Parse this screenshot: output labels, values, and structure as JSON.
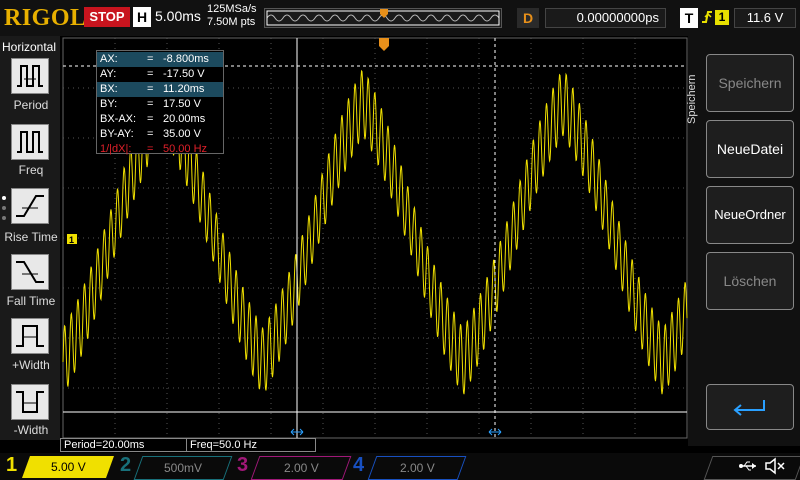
{
  "brand": "RIGOL",
  "run_state": "STOP",
  "horizontal": {
    "label": "H",
    "scale": "5.00ms",
    "sample_rate": "125MSa/s",
    "points": "7.50M pts"
  },
  "delay": {
    "label": "D",
    "value": "0.00000000ps"
  },
  "trigger": {
    "label": "T",
    "edge_icon": "rising-edge-icon",
    "source": "1",
    "level": "11.6 V"
  },
  "left_panel": {
    "title": "Horizontal",
    "items": [
      {
        "label": "Period",
        "icon": "period-measure-icon"
      },
      {
        "label": "Freq",
        "icon": "frequency-measure-icon"
      },
      {
        "label": "Rise Time",
        "icon": "rise-time-icon"
      },
      {
        "label": "Fall Time",
        "icon": "fall-time-icon"
      },
      {
        "label": "+Width",
        "icon": "positive-width-icon"
      },
      {
        "label": "-Width",
        "icon": "negative-width-icon"
      }
    ]
  },
  "right_panel": {
    "title": "Speichern",
    "buttons": [
      {
        "label": "Speichern",
        "enabled": false
      },
      {
        "label": "NeueDatei",
        "enabled": true
      },
      {
        "label": "NeueOrdner",
        "enabled": true
      },
      {
        "label": "Löschen",
        "enabled": false
      },
      {
        "label": "",
        "icon": "enter-return-icon",
        "enabled": true
      }
    ]
  },
  "cursor_table": [
    {
      "key": "AX:",
      "eq": "=",
      "value": "-8.800ms",
      "highlight": true
    },
    {
      "key": "AY:",
      "eq": "=",
      "value": "-17.50 V"
    },
    {
      "key": "BX:",
      "eq": "=",
      "value": "11.20ms",
      "highlight": true
    },
    {
      "key": "BY:",
      "eq": "=",
      "value": "17.50 V"
    },
    {
      "key": "BX-AX:",
      "eq": "=",
      "value": "20.00ms"
    },
    {
      "key": "BY-AY:",
      "eq": "=",
      "value": "35.00 V"
    },
    {
      "key": "1/|dX|:",
      "eq": "=",
      "value": "50.00 Hz",
      "red": true
    }
  ],
  "measurements": {
    "period": "Period=20.00ms",
    "freq": "Freq=50.0 Hz"
  },
  "channels": [
    {
      "num": "1",
      "scale": "5.00 V",
      "color": "#f0e000",
      "active": true
    },
    {
      "num": "2",
      "scale": "500mV",
      "color": "#18a0b0",
      "active": false
    },
    {
      "num": "3",
      "scale": "2.00 V",
      "color": "#c01888",
      "active": false
    },
    {
      "num": "4",
      "scale": "2.00 V",
      "color": "#1858d0",
      "active": false
    }
  ],
  "status_icons": [
    "usb-icon",
    "speaker-mute-icon"
  ],
  "trace_color": "#f0e000"
}
